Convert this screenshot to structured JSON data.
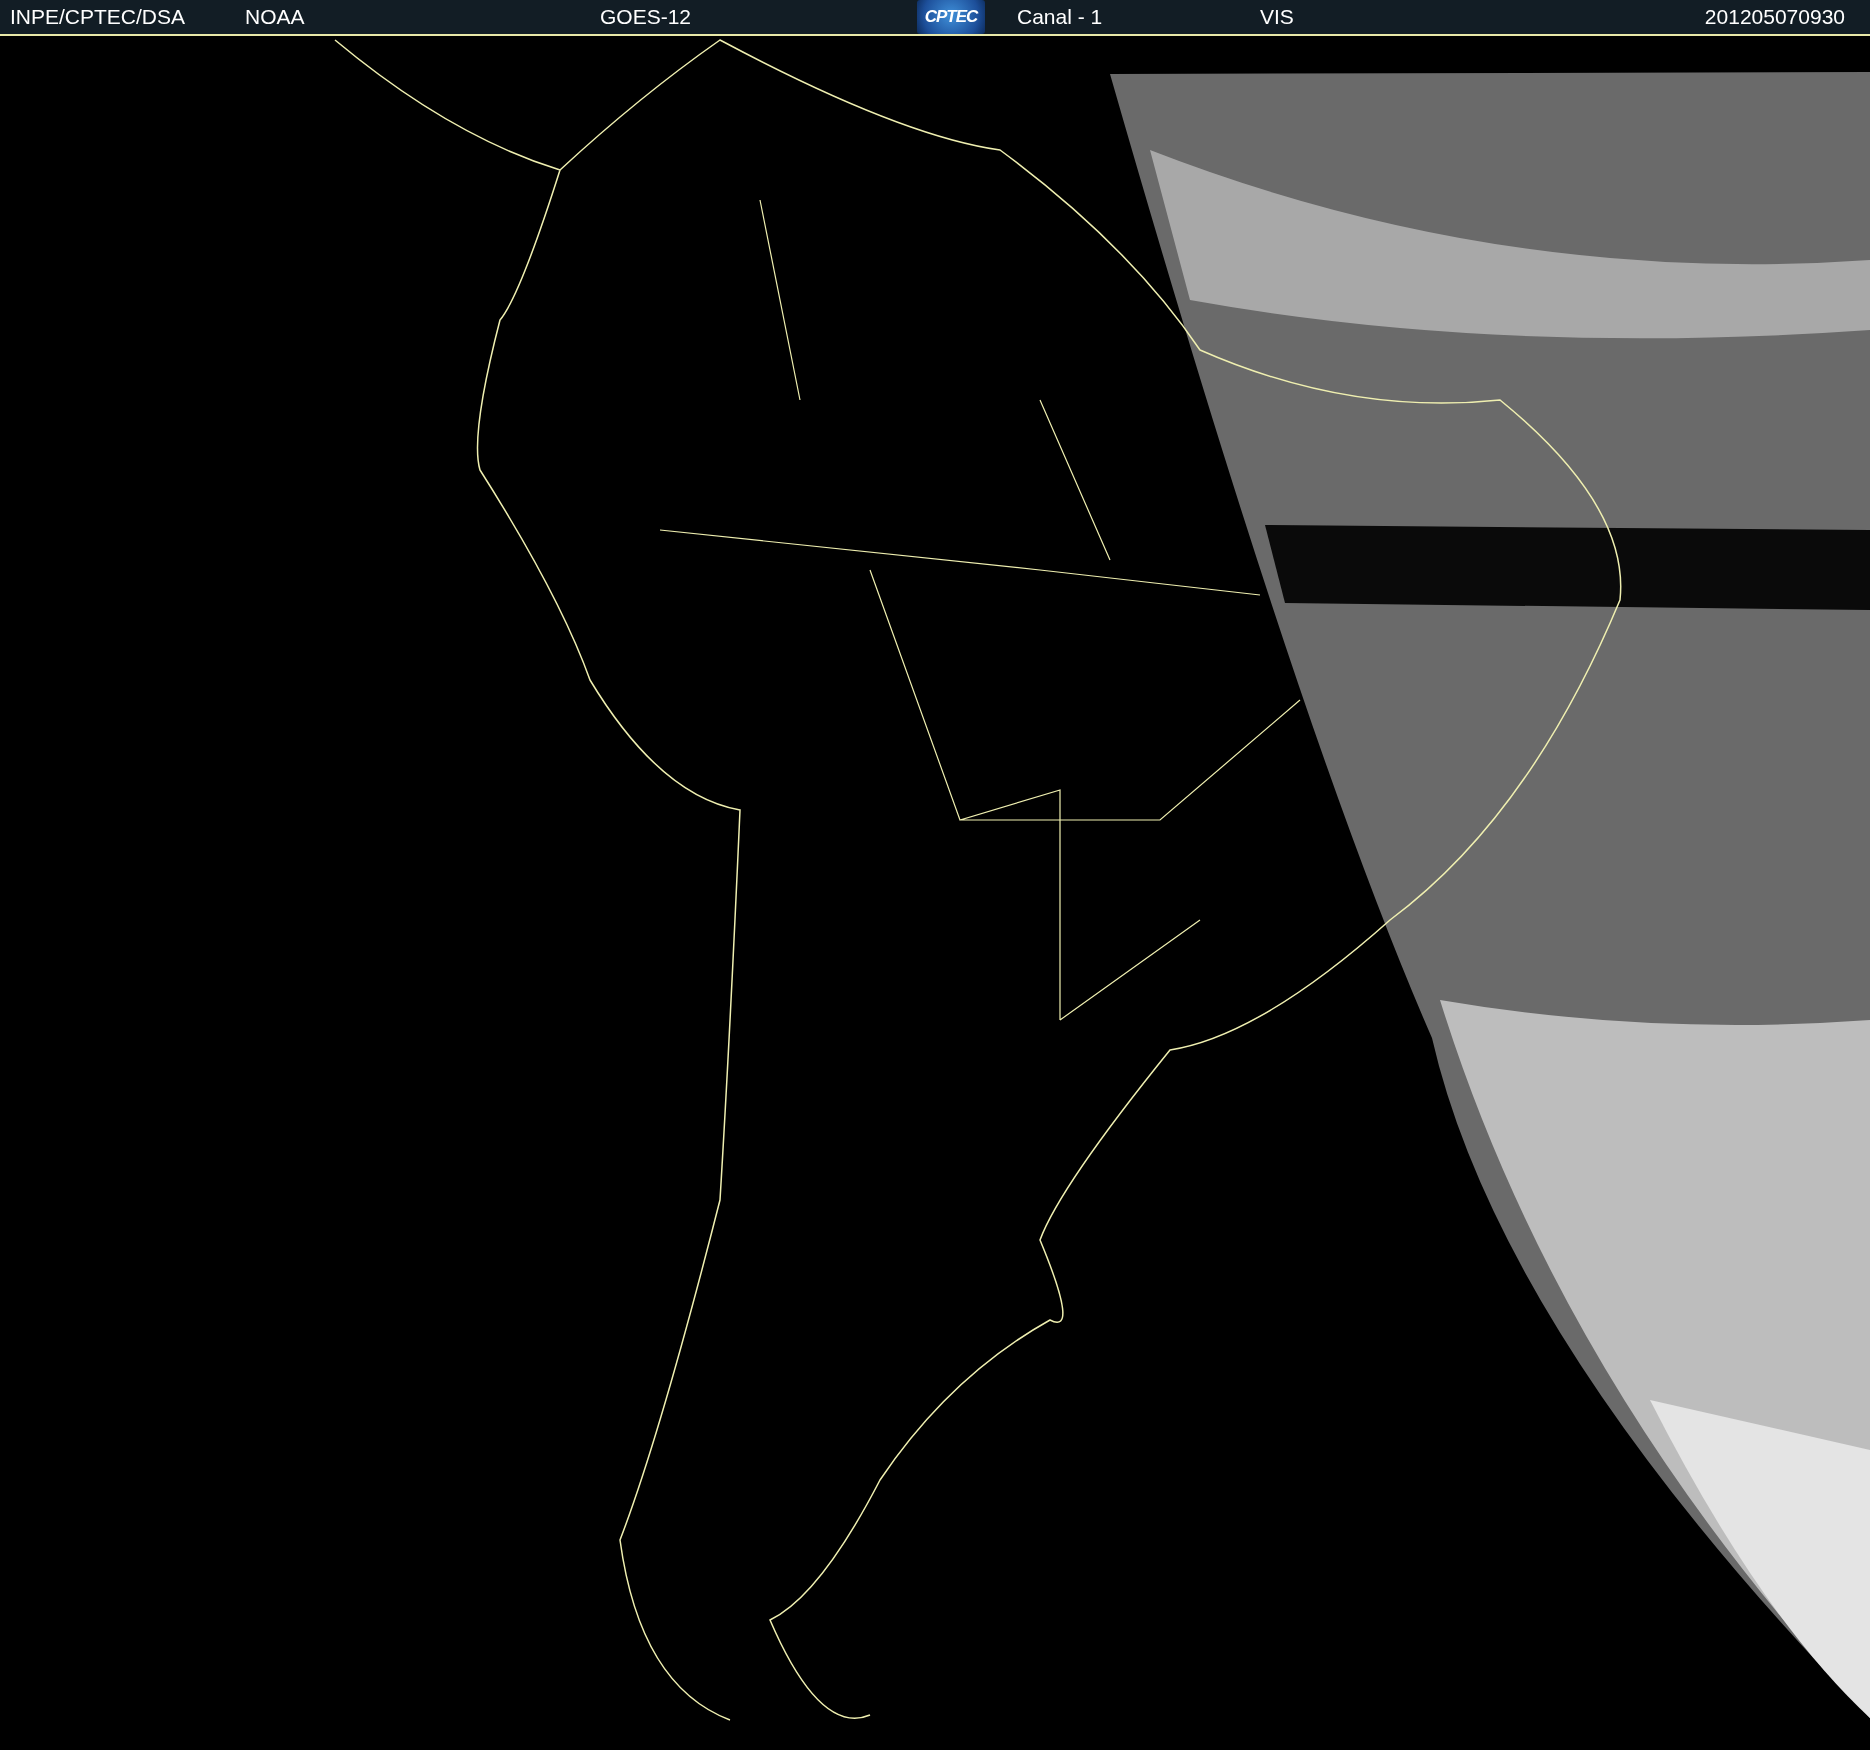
{
  "header": {
    "items": [
      {
        "kind": "text",
        "text": "INPE/CPTEC/DSA"
      },
      {
        "kind": "text",
        "text": "NOAA"
      },
      {
        "kind": "text",
        "text": "GOES-12"
      },
      {
        "kind": "logo",
        "text": "CPTEC"
      },
      {
        "kind": "text",
        "text": "Canal - 1"
      },
      {
        "kind": "text",
        "text": "VIS"
      },
      {
        "kind": "text",
        "text": "201205070930"
      }
    ]
  }
}
